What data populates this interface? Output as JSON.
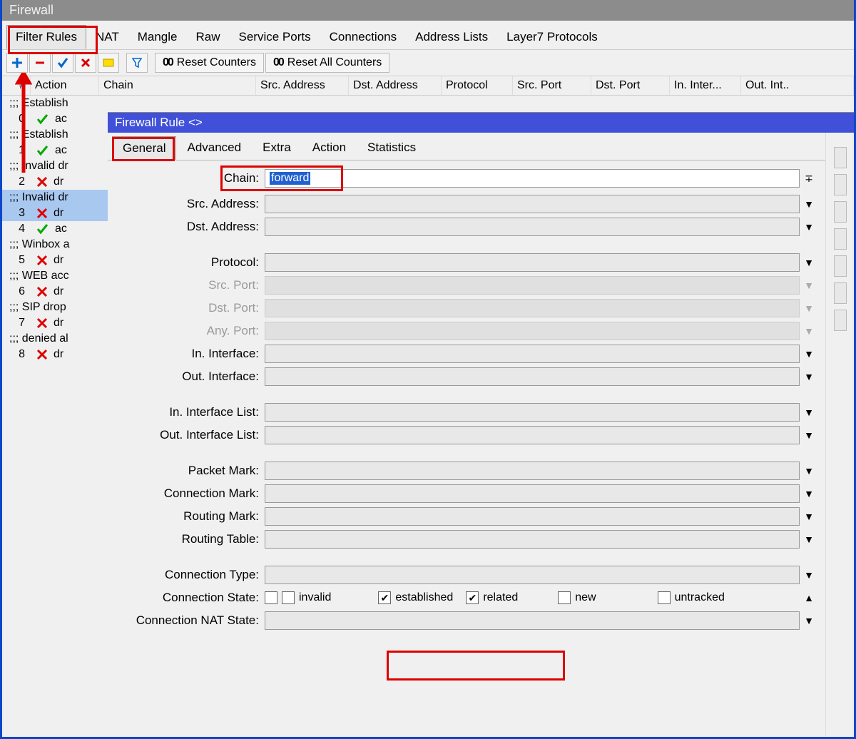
{
  "window_title": "Firewall",
  "tabs": [
    "Filter Rules",
    "NAT",
    "Mangle",
    "Raw",
    "Service Ports",
    "Connections",
    "Address Lists",
    "Layer7 Protocols"
  ],
  "active_tab": 0,
  "toolbar": {
    "reset_counters": "Reset Counters",
    "reset_all_counters": "Reset All Counters"
  },
  "columns": [
    "#",
    "Action",
    "Chain",
    "Src. Address",
    "Dst. Address",
    "Protocol",
    "Src. Port",
    "Dst. Port",
    "In. Inter...",
    "Out. Int.."
  ],
  "rules": [
    {
      "comment": ";;; Establish",
      "num": "0",
      "icon": "check",
      "act": "ac"
    },
    {
      "comment": ";;; Establish",
      "num": "1",
      "icon": "check",
      "act": "ac"
    },
    {
      "comment": ";;; Invalid dr",
      "num": "2",
      "icon": "x",
      "act": "dr"
    },
    {
      "comment": ";;; Invalid dr",
      "num": "3",
      "icon": "x",
      "act": "dr",
      "selected": true
    },
    {
      "comment": "",
      "num": "4",
      "icon": "check",
      "act": "ac"
    },
    {
      "comment": ";;; Winbox a",
      "num": "5",
      "icon": "x",
      "act": "dr"
    },
    {
      "comment": ";;; WEB acc",
      "num": "6",
      "icon": "x",
      "act": "dr"
    },
    {
      "comment": ";;; SIP drop",
      "num": "7",
      "icon": "x",
      "act": "dr"
    },
    {
      "comment": ";;; denied al",
      "num": "8",
      "icon": "x",
      "act": "dr"
    }
  ],
  "dialog": {
    "title": "Firewall Rule <>",
    "tabs": [
      "General",
      "Advanced",
      "Extra",
      "Action",
      "Statistics"
    ],
    "active_tab": 0,
    "fields": {
      "chain": {
        "label": "Chain:",
        "value": "forward"
      },
      "src_address": {
        "label": "Src. Address:"
      },
      "dst_address": {
        "label": "Dst. Address:"
      },
      "protocol": {
        "label": "Protocol:"
      },
      "src_port": {
        "label": "Src. Port:",
        "disabled": true
      },
      "dst_port": {
        "label": "Dst. Port:",
        "disabled": true
      },
      "any_port": {
        "label": "Any. Port:",
        "disabled": true
      },
      "in_interface": {
        "label": "In. Interface:"
      },
      "out_interface": {
        "label": "Out. Interface:"
      },
      "in_interface_list": {
        "label": "In. Interface List:"
      },
      "out_interface_list": {
        "label": "Out. Interface List:"
      },
      "packet_mark": {
        "label": "Packet Mark:"
      },
      "connection_mark": {
        "label": "Connection Mark:"
      },
      "routing_mark": {
        "label": "Routing Mark:"
      },
      "routing_table": {
        "label": "Routing Table:"
      },
      "connection_type": {
        "label": "Connection Type:"
      },
      "connection_state": {
        "label": "Connection State:"
      },
      "connection_nat_state": {
        "label": "Connection NAT State:"
      }
    },
    "conn_state": {
      "invalid": {
        "label": "invalid",
        "checked": false
      },
      "established": {
        "label": "established",
        "checked": true
      },
      "related": {
        "label": "related",
        "checked": true
      },
      "new": {
        "label": "new",
        "checked": false
      },
      "untracked": {
        "label": "untracked",
        "checked": false
      }
    }
  }
}
